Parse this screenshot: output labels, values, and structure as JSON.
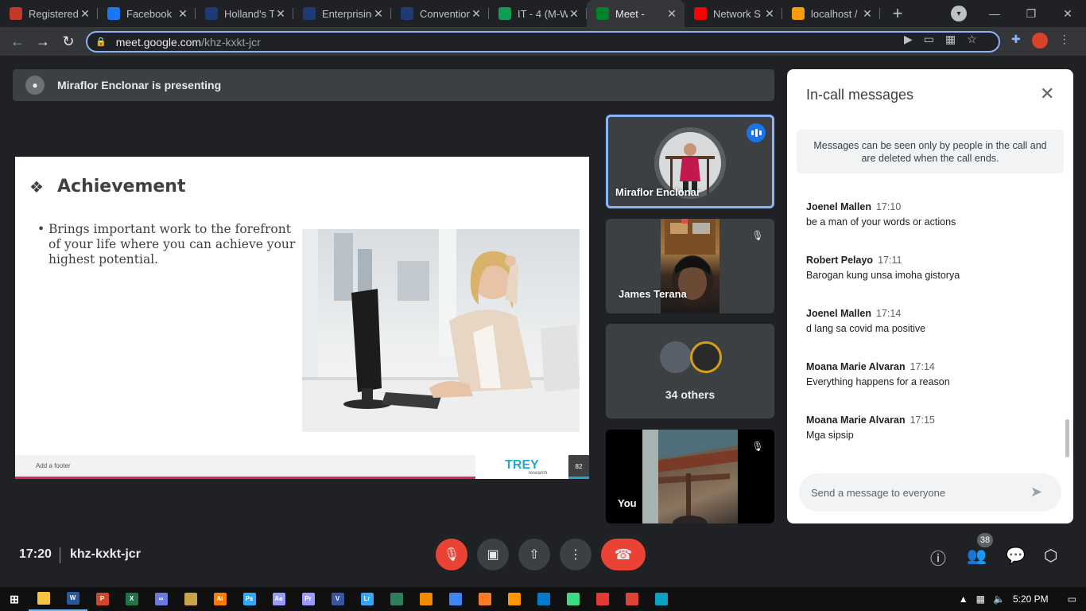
{
  "browser": {
    "tabs": [
      {
        "title": "Registered",
        "color": "#c0392b",
        "active": false
      },
      {
        "title": "Facebook",
        "color": "#1877f2",
        "active": false
      },
      {
        "title": "Holland's T",
        "color": "#1f3b73",
        "active": false
      },
      {
        "title": "Enterprising",
        "color": "#1f3b73",
        "active": false
      },
      {
        "title": "Convention",
        "color": "#1f3b73",
        "active": false
      },
      {
        "title": "IT - 4 (M-W",
        "color": "#0f9d58",
        "active": false
      },
      {
        "title": "Meet - ",
        "color": "#00832d",
        "active": true
      },
      {
        "title": "Network S",
        "color": "#ff0000",
        "active": false
      },
      {
        "title": "localhost /",
        "color": "#f89c0e",
        "active": false
      }
    ],
    "url_host": "meet.google.com",
    "url_path": "/khz-kxkt-jcr"
  },
  "meet": {
    "presenting_text": "Miraflor Enclonar is presenting",
    "slide": {
      "title": "Achievement",
      "bullet": "Brings important work to the forefront of your life where you can achieve your highest potential.",
      "footer": "Add a footer",
      "logo_main": "TREY",
      "logo_sub": "research",
      "page_num": "82"
    },
    "tiles": {
      "presenter_name": "Miraflor Enclonar",
      "participant2_name": "James Terana",
      "others_label": "34 others",
      "self_name": "You"
    },
    "chat": {
      "title": "In-call messages",
      "notice": "Messages can be seen only by people in the call and are deleted when the call ends.",
      "messages": [
        {
          "sender": "Joenel Mallen",
          "time": "17:10",
          "text": "be a man of your words or actions"
        },
        {
          "sender": "Robert Pelayo",
          "time": "17:11",
          "text": "Barogan kung unsa imoha gistorya"
        },
        {
          "sender": "Joenel Mallen",
          "time": "17:14",
          "text": "d lang sa covid ma positive"
        },
        {
          "sender": "Moana Marie Alvaran",
          "time": "17:14",
          "text": "Everything happens for a reason"
        },
        {
          "sender": "Moana Marie Alvaran",
          "time": "17:15",
          "text": "Mga sipsip"
        }
      ],
      "input_placeholder": "Send a message to everyone"
    },
    "bottom": {
      "clock": "17:20",
      "meeting_code": "khz-kxkt-jcr",
      "people_count": "38"
    }
  },
  "taskbar": {
    "apps": [
      {
        "name": "file-explorer",
        "label": "",
        "color": "#f4c542"
      },
      {
        "name": "word",
        "label": "W",
        "color": "#2b579a"
      },
      {
        "name": "powerpoint",
        "label": "P",
        "color": "#d24726"
      },
      {
        "name": "excel",
        "label": "X",
        "color": "#217346"
      },
      {
        "name": "link",
        "label": "∞",
        "color": "#6c7ae0"
      },
      {
        "name": "app",
        "label": "",
        "color": "#c8a34a"
      },
      {
        "name": "illustrator",
        "label": "Ai",
        "color": "#ff7c00"
      },
      {
        "name": "photoshop",
        "label": "Ps",
        "color": "#31a8ff"
      },
      {
        "name": "after-effects",
        "label": "Ae",
        "color": "#9999ff"
      },
      {
        "name": "premiere",
        "label": "Pr",
        "color": "#9999ff"
      },
      {
        "name": "visio",
        "label": "V",
        "color": "#3955a3"
      },
      {
        "name": "lightroom",
        "label": "Lr",
        "color": "#31a8ff"
      },
      {
        "name": "app2",
        "label": "",
        "color": "#2e7d5b"
      },
      {
        "name": "vlc",
        "label": "",
        "color": "#f28c00"
      },
      {
        "name": "chrome",
        "label": "",
        "color": "#4285f4"
      },
      {
        "name": "xampp",
        "label": "",
        "color": "#fb7a24"
      },
      {
        "name": "sublime",
        "label": "",
        "color": "#ff9800"
      },
      {
        "name": "vscode",
        "label": "",
        "color": "#007acc"
      },
      {
        "name": "android",
        "label": "",
        "color": "#3ddc84"
      },
      {
        "name": "recorder",
        "label": "",
        "color": "#e53935"
      },
      {
        "name": "chrome2",
        "label": "",
        "color": "#db4437"
      },
      {
        "name": "photos",
        "label": "",
        "color": "#0aa2c0"
      }
    ],
    "time": "5:20 PM"
  }
}
